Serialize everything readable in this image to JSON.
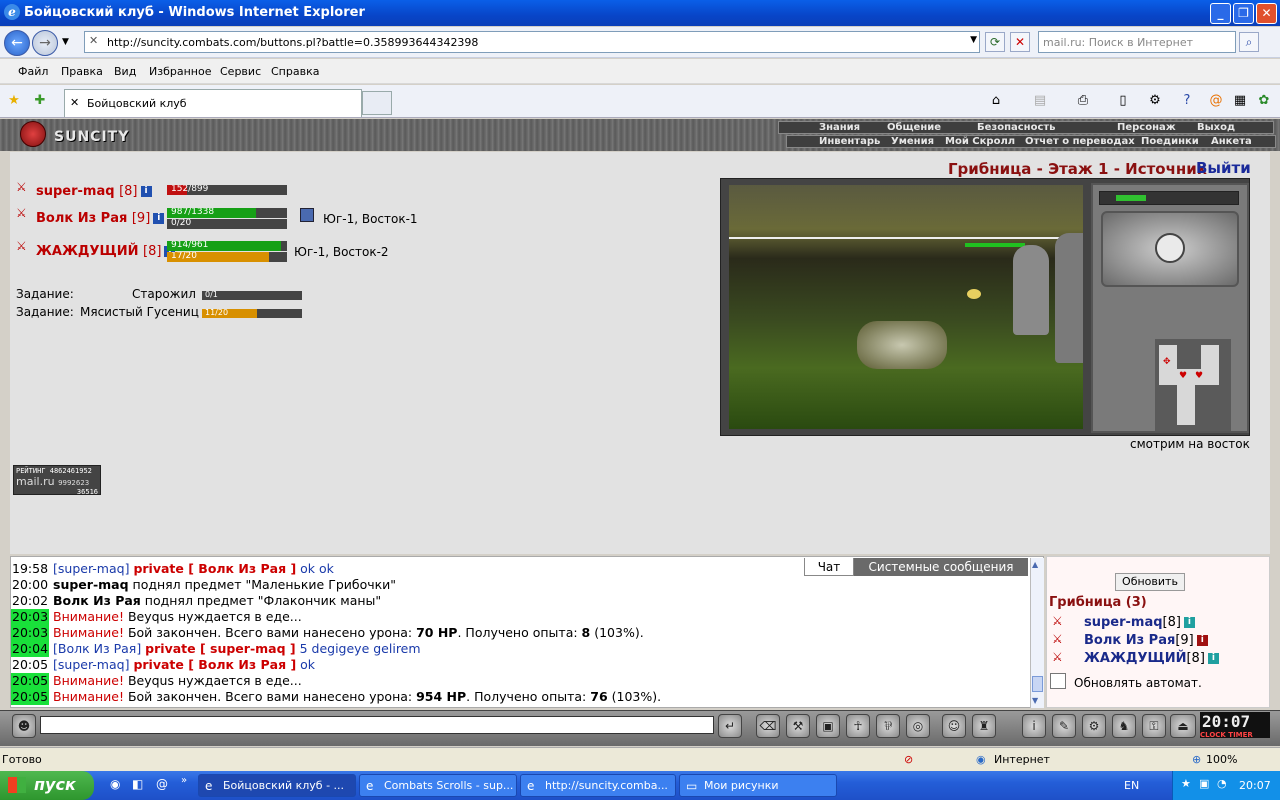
{
  "window": {
    "title": "Бойцовский клуб - Windows Internet Explorer",
    "address": "http://suncity.combats.com/buttons.pl?battle=0.358993644342398",
    "search_placeholder": "mail.ru: Поиск в Интернет",
    "menu": [
      "Файл",
      "Правка",
      "Вид",
      "Избранное",
      "Сервис",
      "Справка"
    ],
    "tab_title": "Бойцовский клуб"
  },
  "game": {
    "logo": "SUNCITY",
    "nav_row1": [
      "Знания",
      "Общение",
      "Безопасность",
      "Персонаж",
      "Выход"
    ],
    "nav_row2": [
      "Инвентарь",
      "Умения",
      "Мой Скролл",
      "Отчет о переводах",
      "Поединки",
      "Анкета"
    ],
    "location_title": "Грибница - Этаж 1 - Источник",
    "exit_label": "Выйти",
    "look_direction": "смотрим на восток",
    "players": [
      {
        "name": "super-maq",
        "level": "[8]",
        "hp_text": "152/899",
        "hp_frac": 0.17
      },
      {
        "name": "Волк Из Рая",
        "level": "[9]",
        "hp_text": "987/1338",
        "hp_frac": 0.74,
        "mp_text": "0/20",
        "mp_frac": 0.0,
        "pos": "Юг-1, Восток-1"
      },
      {
        "name": "ЖАЖДУЩИЙ",
        "level": "[8]",
        "hp_text": "914/961",
        "hp_frac": 0.95,
        "mp_text": "17/20",
        "mp_frac": 0.85,
        "pos": "Юг-1, Восток-2"
      }
    ],
    "quests": [
      {
        "label": "Задание:",
        "name": "Старожил",
        "progress_text": "0/1",
        "progress": 0.0
      },
      {
        "label": "Задание:",
        "name": "Мясистый Гусениц",
        "progress_text": "11/20",
        "progress": 0.55
      }
    ],
    "rating": {
      "title": "РЕЙТИНГ",
      "n1": "4862461952",
      "brand": "mail.ru",
      "n2": "9992623",
      "n3": "36516"
    }
  },
  "chat": {
    "tabs": [
      "Чат",
      "Системные сообщения"
    ],
    "lines": [
      {
        "time": "19:58",
        "pre": "[super-maq] ",
        "priv": "private [ Волк Из Рая ]",
        "msg": " ok ok"
      },
      {
        "time": "20:00",
        "who": "super-maq",
        "msg": " поднял предмет \"Маленькие Грибочки\""
      },
      {
        "time": "20:02",
        "who": "Волк Из Рая",
        "msg": " поднял предмет \"Флакончик маны\""
      },
      {
        "time": "20:03",
        "att": "Внимание!",
        "msg": " Beyqus нуждается в еде..."
      },
      {
        "time": "20:03",
        "att": "Внимание!",
        "msg": " Бой закончен. Всего вами нанесено урона: ",
        "b1": "70 HP",
        "m2": ". Получено опыта: ",
        "b2": "8",
        "m3": " (103%)."
      },
      {
        "time": "20:04",
        "pre": "[Волк Из Рая] ",
        "priv": "private [ super-maq ]",
        "msg": " 5 degigeye gelirem"
      },
      {
        "time": "20:05",
        "pre": "[super-maq] ",
        "priv": "private [ Волк Из Рая ]",
        "msg": " ok"
      },
      {
        "time": "20:05",
        "att": "Внимание!",
        "msg": " Beyqus нуждается в еде..."
      },
      {
        "time": "20:05",
        "att": "Внимание!",
        "msg": " Бой закончен. Всего вами нанесено урона: ",
        "b1": "954 HP",
        "m2": ". Получено опыта: ",
        "b2": "76",
        "m3": " (103%)."
      }
    ]
  },
  "room": {
    "refresh_label": "Обновить",
    "title": "Грибница (3)",
    "members": [
      {
        "name": "super-maq",
        "level": "[8]"
      },
      {
        "name": "Волк Из Рая",
        "level": "[9]"
      },
      {
        "name": "ЖАЖДУЩИЙ",
        "level": "[8]"
      }
    ],
    "auto_label": "Обновлять автомат."
  },
  "clock": {
    "time": "20:07",
    "label": "CLOCK TIMER"
  },
  "status": {
    "left": "Готово",
    "zone": "Интернет",
    "zoom": "100%"
  },
  "taskbar": {
    "start": "пуск",
    "tasks": [
      "Бойцовский клуб - ...",
      "Combats Scrolls - sup...",
      "http://suncity.comba...",
      "Мои рисунки"
    ],
    "lang": "EN",
    "time": "20:07"
  }
}
